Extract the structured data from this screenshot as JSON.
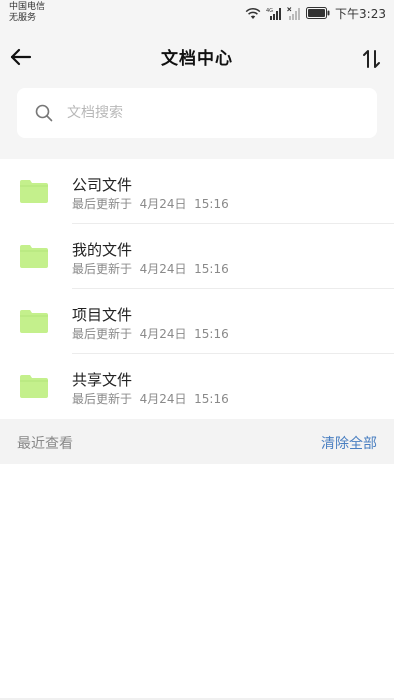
{
  "status_bar": {
    "carrier_line1": "中国电信",
    "carrier_line2": "无服务",
    "time": "下午3:23",
    "network_badge": "4G"
  },
  "header": {
    "title": "文档中心",
    "back_icon": "arrow-left-icon",
    "sort_icon": "sort-arrows-icon"
  },
  "search": {
    "placeholder": "文档搜索",
    "icon": "search-icon"
  },
  "folders": [
    {
      "name": "公司文件",
      "meta": "最后更新于  4月24日  15:16"
    },
    {
      "name": "我的文件",
      "meta": "最后更新于  4月24日  15:16"
    },
    {
      "name": "项目文件",
      "meta": "最后更新于  4月24日  15:16"
    },
    {
      "name": "共享文件",
      "meta": "最后更新于  4月24日  15:16"
    }
  ],
  "recent": {
    "label": "最近查看",
    "clear_label": "清除全部"
  },
  "colors": {
    "folder": "#c4f08c",
    "link": "#4a7fc1",
    "background": "#f5f5f5"
  }
}
